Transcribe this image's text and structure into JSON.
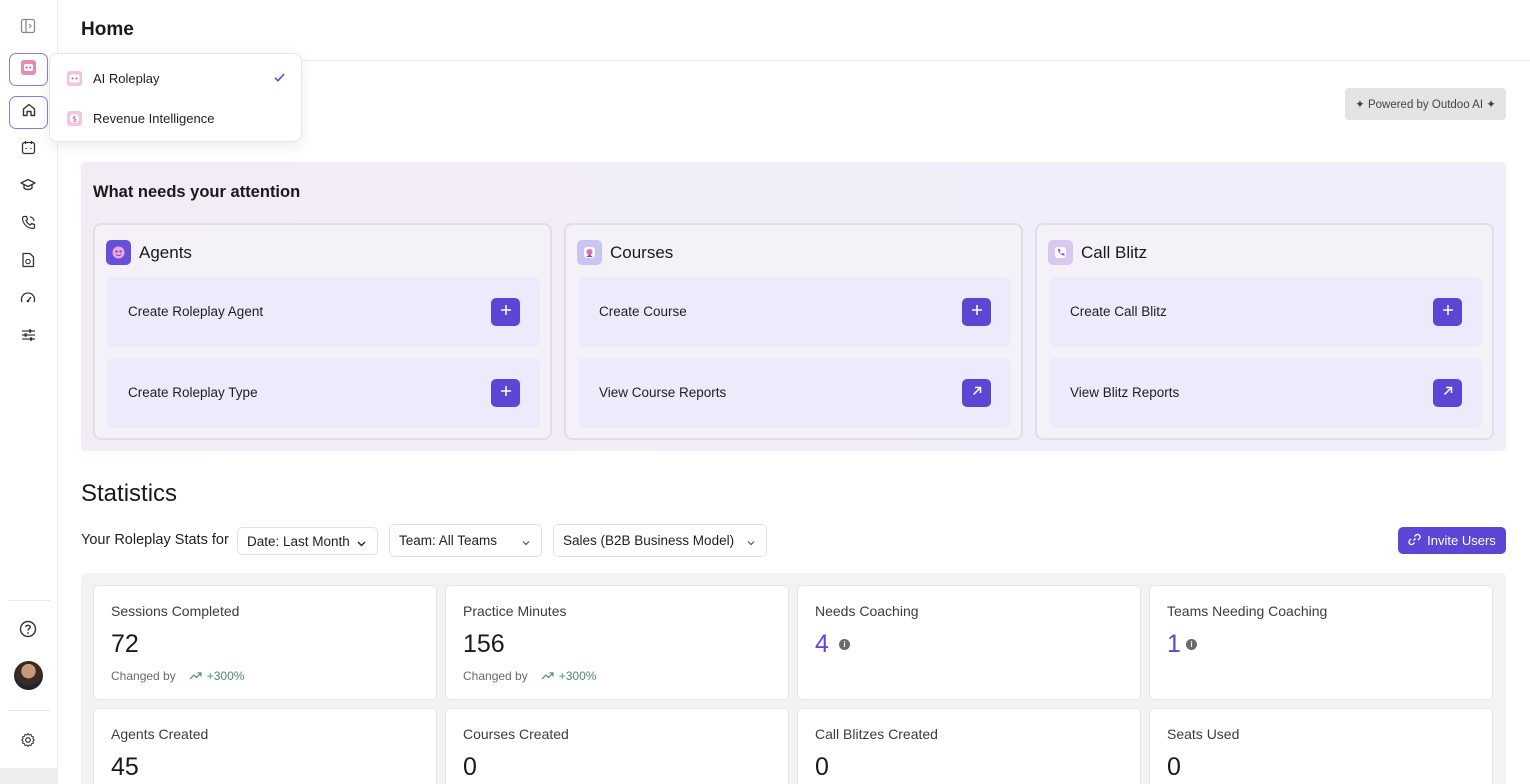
{
  "header": {
    "title": "Home"
  },
  "app_switcher": {
    "items": [
      {
        "label": "AI Roleplay",
        "selected": true
      },
      {
        "label": "Revenue Intelligence",
        "selected": false
      }
    ]
  },
  "powered_by": "✦ Powered by Outdoo AI ✦",
  "attention": {
    "title": "What needs your attention",
    "cards": [
      {
        "title": "Agents",
        "actions": [
          {
            "label": "Create Roleplay Agent",
            "icon": "plus-icon"
          },
          {
            "label": "Create Roleplay Type",
            "icon": "plus-icon"
          }
        ]
      },
      {
        "title": "Courses",
        "actions": [
          {
            "label": "Create Course",
            "icon": "plus-icon"
          },
          {
            "label": "View Course Reports",
            "icon": "arrow-up-right-icon"
          }
        ]
      },
      {
        "title": "Call Blitz",
        "actions": [
          {
            "label": "Create Call Blitz",
            "icon": "plus-icon"
          },
          {
            "label": "View Blitz Reports",
            "icon": "arrow-up-right-icon"
          }
        ]
      }
    ]
  },
  "statistics": {
    "title": "Statistics",
    "stats_for_label": "Your Roleplay Stats for",
    "filters": {
      "date": "Date: Last Month",
      "team": "Team: All Teams",
      "model": "Sales (B2B Business Model)"
    },
    "invite_label": "Invite Users",
    "cards": [
      {
        "label": "Sessions Completed",
        "value": "72",
        "changed_label": "Changed by",
        "change": "+300%"
      },
      {
        "label": "Practice Minutes",
        "value": "156",
        "changed_label": "Changed by",
        "change": "+300%"
      },
      {
        "label": "Needs Coaching",
        "value": "4"
      },
      {
        "label": "Teams Needing Coaching",
        "value": "1"
      },
      {
        "label": "Agents Created",
        "value": "45"
      },
      {
        "label": "Courses Created",
        "value": "0"
      },
      {
        "label": "Call Blitzes Created",
        "value": "0"
      },
      {
        "label": "Seats Used",
        "value": "0"
      }
    ]
  },
  "colors": {
    "accent": "#5b46d6",
    "positive": "#4b8f68",
    "attention_bg": "#f1eef9",
    "action_bg": "#ebebfb"
  }
}
